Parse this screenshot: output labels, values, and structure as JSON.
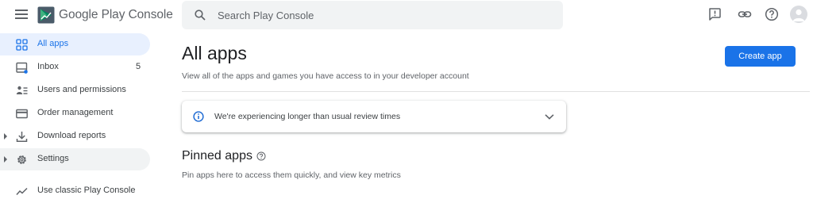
{
  "brand": {
    "google_play": "Google Play",
    "console": "Console"
  },
  "search": {
    "placeholder": "Search Play Console"
  },
  "topbar_icons": [
    "feedback-icon",
    "link-icon",
    "help-icon",
    "avatar"
  ],
  "sidebar": {
    "items": [
      {
        "label": "All apps",
        "icon": "grid-icon",
        "active": true
      },
      {
        "label": "Inbox",
        "icon": "inbox-icon",
        "count": "5"
      },
      {
        "label": "Users and permissions",
        "icon": "users-permissions-icon"
      },
      {
        "label": "Order management",
        "icon": "credit-card-icon"
      },
      {
        "label": "Download reports",
        "icon": "download-icon",
        "expandable": true
      },
      {
        "label": "Settings",
        "icon": "gear-icon",
        "expandable": true
      },
      {
        "label": "Use classic Play Console",
        "icon": "trend-icon"
      }
    ]
  },
  "main": {
    "title": "All apps",
    "subtitle": "View all of the apps and games you have access to in your developer account",
    "create_button": "Create app",
    "notice": "We're experiencing longer than usual review times",
    "pinned": {
      "title": "Pinned apps",
      "subtitle": "Pin apps here to access them quickly, and view key metrics"
    }
  },
  "colors": {
    "accent": "#1a73e8",
    "active_bg": "#e8f0fe",
    "text": "#202124",
    "muted": "#5f6368"
  }
}
